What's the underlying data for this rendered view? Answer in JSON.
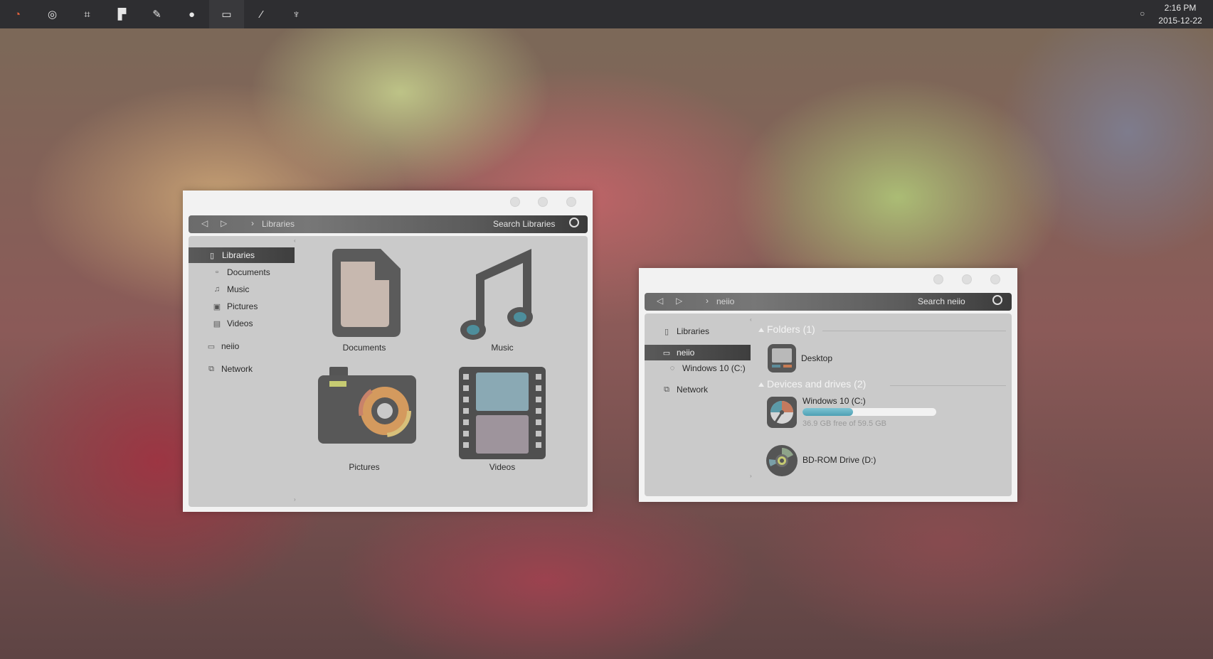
{
  "taskbar": {
    "items": [
      {
        "icon": "color-wheel-icon",
        "glyph": "◔",
        "color": "#e8643c"
      },
      {
        "icon": "chrome-icon",
        "glyph": "◎"
      },
      {
        "icon": "crop-icon",
        "glyph": "⌗"
      },
      {
        "icon": "tiles-icon",
        "glyph": "▛"
      },
      {
        "icon": "feather-icon",
        "glyph": "✎"
      },
      {
        "icon": "disc-icon",
        "glyph": "●"
      },
      {
        "icon": "monitor-icon",
        "glyph": "▭",
        "active": true
      },
      {
        "icon": "brush-icon",
        "glyph": "⁄"
      },
      {
        "icon": "gamepad-icon",
        "glyph": "♆"
      }
    ],
    "time": "2:16 PM",
    "date": "2015-12-22",
    "tray_glyph": "○"
  },
  "libraries_window": {
    "nav_back": "◁",
    "nav_forward": "▷",
    "crumb_sep": "›",
    "breadcrumb": "Libraries",
    "search_placeholder": "Search Libraries",
    "sidebar": [
      {
        "label": "Libraries",
        "glyph": "▯"
      },
      {
        "label": "Documents",
        "glyph": "▫"
      },
      {
        "label": "Music",
        "glyph": "♫"
      },
      {
        "label": "Pictures",
        "glyph": "▣"
      },
      {
        "label": "Videos",
        "glyph": "▤"
      },
      {
        "label": "neiio",
        "glyph": "▭"
      },
      {
        "label": "Network",
        "glyph": "⧉"
      }
    ],
    "items": [
      {
        "label": "Documents",
        "icon": "document-icon"
      },
      {
        "label": "Music",
        "icon": "music-note-icon"
      },
      {
        "label": "Pictures",
        "icon": "camera-icon"
      },
      {
        "label": "Videos",
        "icon": "film-icon"
      }
    ]
  },
  "computer_window": {
    "nav_back": "◁",
    "nav_forward": "▷",
    "crumb_sep": "›",
    "breadcrumb": "neiio",
    "search_placeholder": "Search neiio",
    "sidebar": [
      {
        "label": "Libraries",
        "glyph": "▯"
      },
      {
        "label": "neiio",
        "glyph": "▭"
      },
      {
        "label": "Windows 10 (C:)",
        "glyph": "◌"
      },
      {
        "label": "Network",
        "glyph": "⧉"
      }
    ],
    "folders_title": "Folders (1)",
    "folders": [
      {
        "label": "Desktop",
        "icon": "desktop-icon"
      }
    ],
    "drives_title": "Devices and drives (2)",
    "drives": [
      {
        "label": "Windows 10 (C:)",
        "free_text": "36.9 GB free of 59.5 GB",
        "used_fraction": 0.38,
        "icon": "hard-drive-icon"
      },
      {
        "label": "BD-ROM Drive (D:)",
        "icon": "optical-disc-icon"
      }
    ]
  },
  "colors": {
    "taskbar": "#2e2e31",
    "progress": "#5aaabd",
    "selected": "#4a4a4a"
  }
}
